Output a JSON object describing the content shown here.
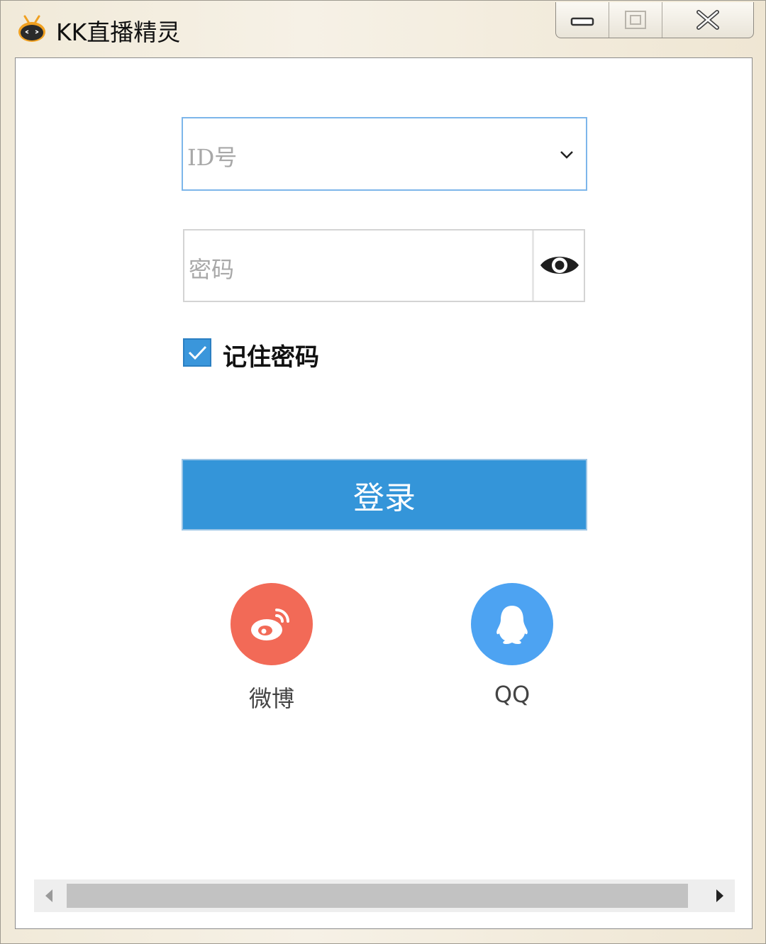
{
  "window": {
    "title": "KK直播精灵"
  },
  "form": {
    "id_placeholder": "ID号",
    "password_placeholder": "密码",
    "remember_label": "记住密码",
    "remember_checked": true,
    "login_label": "登录"
  },
  "social": {
    "weibo_label": "微博",
    "qq_label": "QQ"
  },
  "colors": {
    "login_button": "#3495d9",
    "weibo": "#f26a57",
    "qq": "#4da3f2",
    "checkbox": "#3a96db",
    "focus_border": "#7db6ea"
  },
  "icons": [
    "app-logo-icon",
    "minimize-icon",
    "maximize-icon",
    "close-icon",
    "chevron-down-icon",
    "eye-icon",
    "check-icon",
    "weibo-icon",
    "qq-icon",
    "scroll-left-icon",
    "scroll-right-icon"
  ]
}
